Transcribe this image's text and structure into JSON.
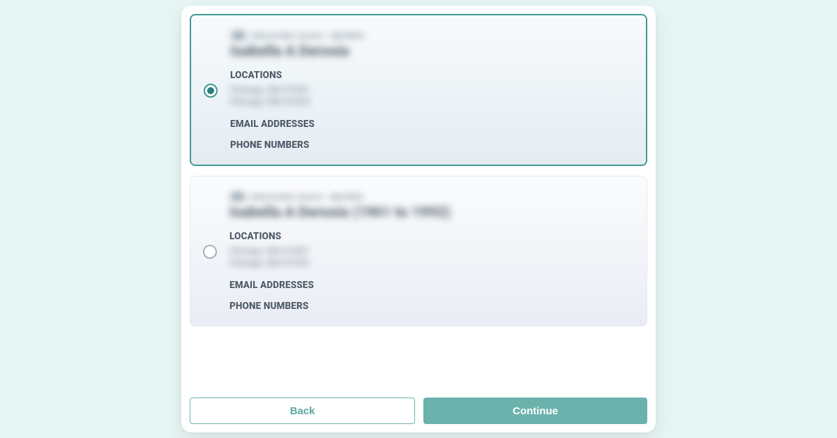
{
  "labels": {
    "locations": "LOCATIONS",
    "emails": "EMAIL ADDRESSES",
    "phones": "PHONE NUMBERS"
  },
  "buttons": {
    "back": "Back",
    "continue": "Continue"
  },
  "options": [
    {
      "selected": true,
      "blurred": true,
      "meta_tag": "ID",
      "meta_text": "data broker source · identifier",
      "name": "Isabella A Derosia",
      "locations": [
        "Chicago, MA 01001",
        "Chicago, MA 01022"
      ]
    },
    {
      "selected": false,
      "blurred": true,
      "meta_tag": "ID",
      "meta_text": "data broker source · identifier",
      "name": "Isabella A Derosia (1961 to 1992)",
      "locations": [
        "Chicago, MA 01001",
        "Chicago, MA 01022"
      ]
    }
  ]
}
